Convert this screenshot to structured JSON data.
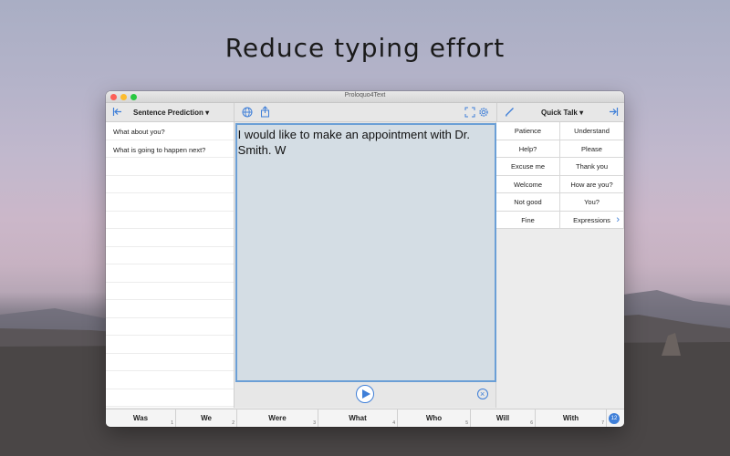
{
  "hero": {
    "title": "Reduce typing effort"
  },
  "window": {
    "title": "Proloquo4Text"
  },
  "toolbar": {
    "prediction_dropdown": "Sentence Prediction",
    "quicktalk_dropdown": "Quick Talk"
  },
  "predictions": [
    "What about you?",
    "What is going to happen next?",
    "",
    "",
    "",
    "",
    "",
    "",
    "",
    "",
    "",
    "",
    "",
    "",
    "",
    ""
  ],
  "editor": {
    "text": "I would like to make an appointment with Dr. Smith.  W"
  },
  "quick_talk": [
    "Patience",
    "Understand",
    "Help?",
    "Please",
    "Excuse me",
    "Thank you",
    "Welcome",
    "How are you?",
    "Not good",
    "You?",
    "Fine",
    "Expressions"
  ],
  "word_suggestions": [
    {
      "word": "Was",
      "num": "1"
    },
    {
      "word": "We",
      "num": "2"
    },
    {
      "word": "Were",
      "num": "3"
    },
    {
      "word": "What",
      "num": "4"
    },
    {
      "word": "Who",
      "num": "5"
    },
    {
      "word": "Will",
      "num": "6"
    },
    {
      "word": "With",
      "num": "7"
    }
  ],
  "wordbar_badge": "12",
  "colors": {
    "accent": "#3f7fd8",
    "editor_bg": "#d4dde4",
    "editor_border": "#6b9fd6"
  }
}
